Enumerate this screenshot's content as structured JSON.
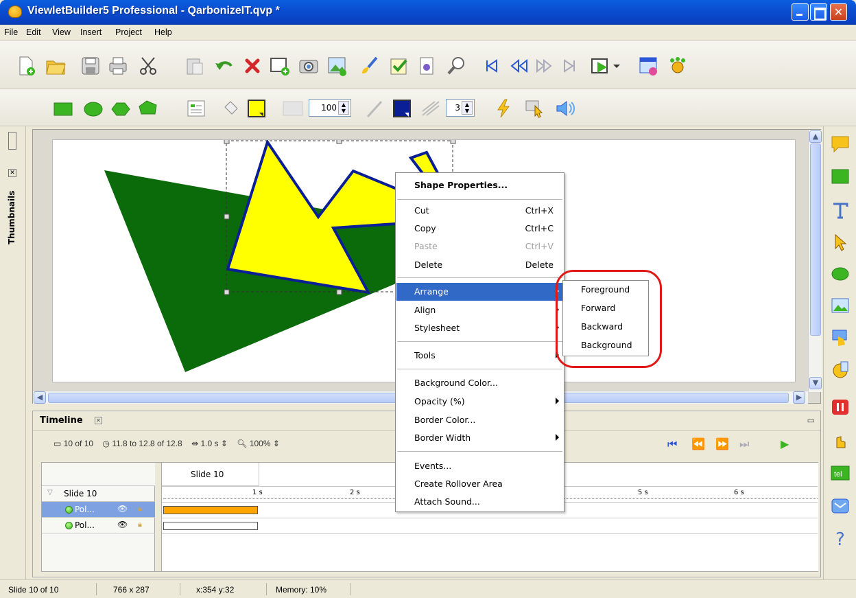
{
  "window": {
    "title": "ViewletBuilder5 Professional - QarbonizeIT.qvp *"
  },
  "menubar": [
    "File",
    "Edit",
    "View",
    "Insert",
    "Project",
    "Help"
  ],
  "toolbar2": {
    "opacity_value": "100",
    "border_width_value": "3"
  },
  "left_dock": {
    "thumbnails_label": "Thumbnails"
  },
  "timeline": {
    "title": "Timeline",
    "slide_counter": "10 of 10",
    "time_range": "11.8 to 12.8 of 12.8",
    "duration": "1.0 s",
    "zoom": "100%",
    "slide_header": "Slide 10",
    "slide_row": "Slide 10",
    "objects": [
      "Pol...",
      "Pol..."
    ],
    "ticks": [
      "1 s",
      "2 s",
      "5 s",
      "6 s"
    ]
  },
  "context_menu": {
    "title": "Shape Properties...",
    "items": [
      {
        "label": "Cut",
        "shortcut": "Ctrl+X"
      },
      {
        "label": "Copy",
        "shortcut": "Ctrl+C"
      },
      {
        "label": "Paste",
        "shortcut": "Ctrl+V"
      },
      {
        "label": "Delete",
        "shortcut": "Delete"
      },
      {
        "label": "Arrange"
      },
      {
        "label": "Align"
      },
      {
        "label": "Stylesheet"
      },
      {
        "label": "Tools"
      },
      {
        "label": "Background Color..."
      },
      {
        "label": "Opacity (%)"
      },
      {
        "label": "Border Color..."
      },
      {
        "label": "Border Width"
      },
      {
        "label": "Events..."
      },
      {
        "label": "Create Rollover Area"
      },
      {
        "label": "Attach Sound..."
      }
    ]
  },
  "arrange_submenu": [
    "Foreground",
    "Forward",
    "Backward",
    "Background"
  ],
  "status": {
    "slide": "Slide 10 of 10",
    "size": "766 x 287",
    "coords": "x:354 y:32",
    "memory": "Memory: 10%"
  },
  "colors": {
    "shape_green": "#0b6b0b",
    "shape_yellow": "#ffff00",
    "shape_border": "#0a1f96",
    "highlight": "#3169c6",
    "timeline_bar": "#ffa500"
  }
}
